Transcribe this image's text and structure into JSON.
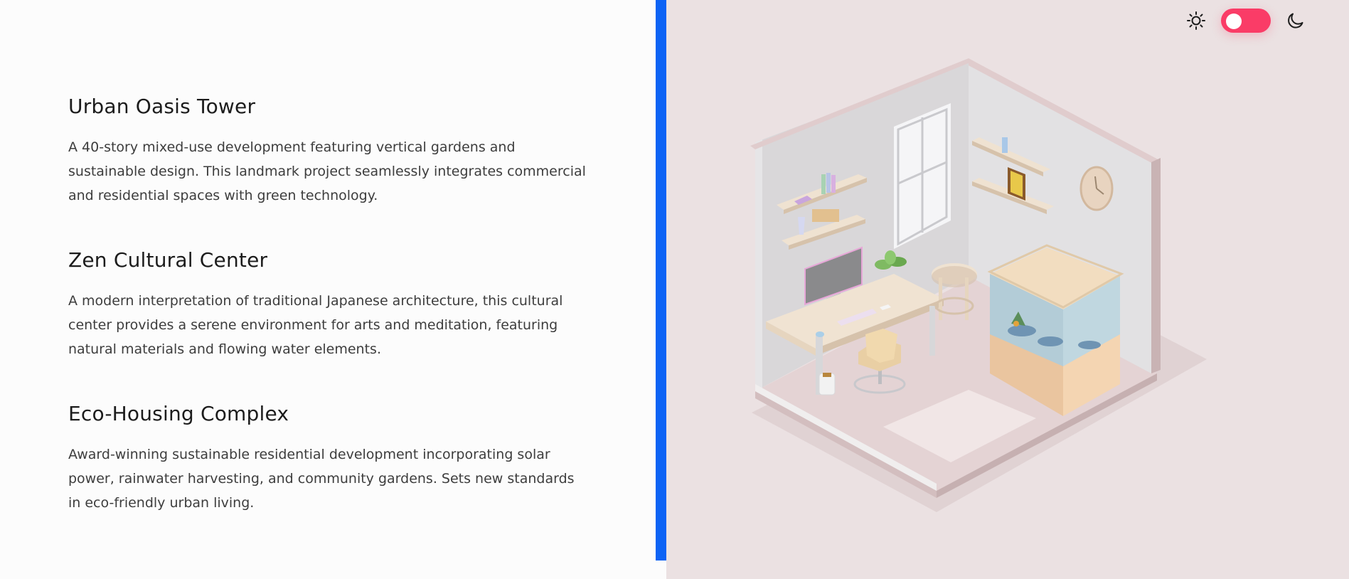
{
  "projects": [
    {
      "title": "Urban Oasis Tower",
      "description": "A 40-story mixed-use development featuring vertical gardens and sustainable design. This landmark project seamlessly integrates commercial and residential spaces with green technology."
    },
    {
      "title": "Zen Cultural Center",
      "description": "A modern interpretation of traditional Japanese architecture, this cultural center provides a serene environment for arts and meditation, featuring natural materials and flowing water elements."
    },
    {
      "title": "Eco-Housing Complex",
      "description": "Award-winning sustainable residential development incorporating solar power, rainwater harvesting, and community gardens. Sets new standards in eco-friendly urban living."
    }
  ],
  "theme_toggle": {
    "light_icon": "sun-icon",
    "dark_icon": "moon-icon",
    "state": "light",
    "track_color": "#fa3c67"
  },
  "colors": {
    "accent": "#0d63f5",
    "right_background": "#ebe1e2",
    "left_background": "#fcfcfc"
  },
  "illustration": {
    "subject": "isometric-room"
  }
}
